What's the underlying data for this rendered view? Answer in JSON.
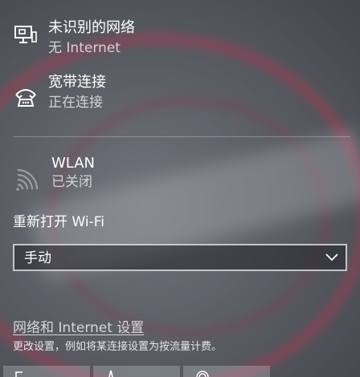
{
  "networks": [
    {
      "title": "未识别的网络",
      "status": "无 Internet",
      "icon": "ethernet-monitor-icon"
    },
    {
      "title": "宽带连接",
      "status": "正在连接",
      "icon": "dialup-phone-icon"
    },
    {
      "title": "WLAN",
      "status": "已关闭",
      "icon": "wifi-signal-icon"
    }
  ],
  "wifi_reenable": {
    "label": "重新打开 Wi-Fi",
    "selected": "手动"
  },
  "settings": {
    "link": "网络和 Internet 设置",
    "description": "更改设置，例如将某连接设置为按流量计费。"
  },
  "quick_actions": [
    {
      "icon": "network-tile-icon"
    },
    {
      "icon": "airplane-mode-icon"
    },
    {
      "icon": "mobile-hotspot-icon"
    }
  ],
  "colors": {
    "text": "#ffffff",
    "secondary_text": "#d2d4d9",
    "divider": "rgba(255,255,255,0.28)"
  }
}
